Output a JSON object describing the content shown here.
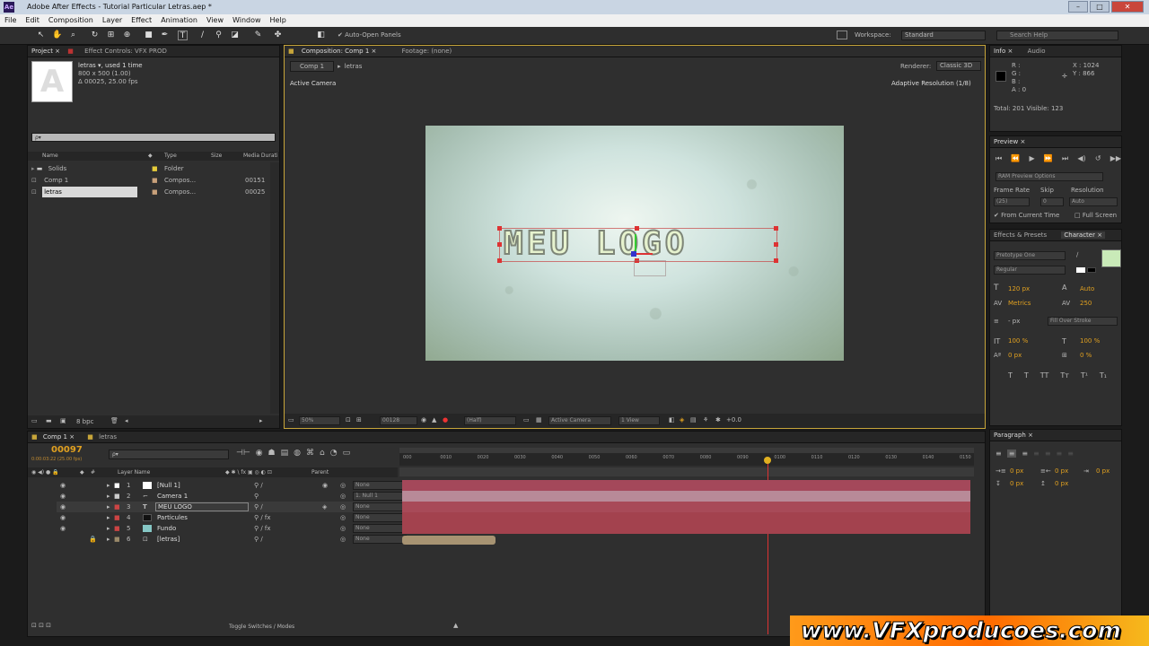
{
  "window": {
    "title": "Adobe After Effects - Tutorial Particular Letras.aep *",
    "app_badge": "Ae"
  },
  "menu": [
    "File",
    "Edit",
    "Composition",
    "Layer",
    "Effect",
    "Animation",
    "View",
    "Window",
    "Help"
  ],
  "toolbar": {
    "auto_open_panels": "Auto-Open Panels",
    "workspace_label": "Workspace:",
    "workspace_value": "Standard",
    "search_help": "Search Help"
  },
  "project": {
    "tab_project": "Project ×",
    "tab_effect_controls": "Effect Controls: VFX PROD",
    "item_name": "letras ▾",
    "item_used": ", used 1 time",
    "item_size": "800 x 500 (1.00)",
    "item_duration": "Δ 00025, 25.00 fps",
    "columns": [
      "Name",
      "Type",
      "Size",
      "Media Durati"
    ],
    "items": [
      {
        "name": "Solids",
        "type": "Folder",
        "dur": ""
      },
      {
        "name": "Comp 1",
        "type": "Compos...",
        "dur": "00151"
      },
      {
        "name": "letras",
        "type": "Compos...",
        "dur": "00025"
      }
    ],
    "bpc": "8 bpc"
  },
  "composition": {
    "tab": "Composition: Comp 1 ×",
    "footage_tab": "Footage: (none)",
    "breadcrumb": [
      "Comp 1",
      "letras"
    ],
    "renderer_label": "Renderer:",
    "renderer_value": "Classic 3D",
    "active_camera": "Active Camera",
    "adaptive": "Adaptive Resolution (1/8)",
    "logo_text": "MEU LOGO",
    "zoom": "50%",
    "timecode": "00128",
    "resolution": "(Half)",
    "camera_view": "Active Camera",
    "views": "1 View",
    "exposure": "+0.0"
  },
  "info": {
    "tab_info": "Info ×",
    "tab_audio": "Audio",
    "rgb": [
      "R :",
      "G :",
      "B :",
      "A : 0"
    ],
    "x": "X : 1024",
    "y": "Y : 866",
    "total": "Total: 201   Visible: 123"
  },
  "preview": {
    "tab": "Preview ×",
    "ram_options": "RAM Preview Options",
    "frame_rate_label": "Frame Rate",
    "skip_label": "Skip",
    "resolution_label": "Resolution",
    "frame_rate": "(25)",
    "skip": "0",
    "resolution": "Auto",
    "from_current": "From Current Time",
    "full_screen": "Full Screen"
  },
  "character": {
    "tab_effects": "Effects & Presets",
    "tab_character": "Character ×",
    "font": "Pretotype One",
    "style": "Regular",
    "size": "120 px",
    "leading": "Auto",
    "kerning": "Metrics",
    "tracking": "250",
    "stroke_width": "- px",
    "stroke_type": "Fill Over Stroke",
    "vscale": "100 %",
    "hscale": "100 %",
    "baseline": "0 px",
    "tsume": "0 %",
    "text_color": "#c9eab8"
  },
  "paragraph": {
    "tab": "Paragraph ×",
    "indent_left": "0 px",
    "indent_right": "0 px",
    "space_before": "0 px",
    "indent_first": "0 px",
    "space_after": "0 px"
  },
  "timeline": {
    "tab_comp": "Comp 1 ×",
    "tab_letras": "letras",
    "timecode": "00097",
    "timecode_sub": "0:00:03:22 (25.00 fps)",
    "search_placeholder": "ρ▾",
    "header_layer": "Layer Name",
    "header_parent": "Parent",
    "ruler": [
      "000",
      "0010",
      "0020",
      "0030",
      "0040",
      "0050",
      "0060",
      "0070",
      "0080",
      "0090",
      "0100",
      "0110",
      "0120",
      "0130",
      "0140",
      "0150"
    ],
    "layers": [
      {
        "num": "1",
        "name": "[Null 1]",
        "parent": "None",
        "label_color": "#ffffff"
      },
      {
        "num": "2",
        "name": "Camera 1",
        "parent": "1. Null 1",
        "label_color": "#cccccc"
      },
      {
        "num": "3",
        "name": "MEU LOGO",
        "parent": "None",
        "label_color": "#cc4444"
      },
      {
        "num": "4",
        "name": "Particules",
        "parent": "None",
        "label_color": "#111111"
      },
      {
        "num": "5",
        "name": "Fundo",
        "parent": "None",
        "label_color": "#86c7c5"
      },
      {
        "num": "6",
        "name": "[letras]",
        "parent": "None",
        "label_color": "#9a8a6a"
      }
    ],
    "toggle": "Toggle Switches / Modes"
  },
  "watermark": "www.VFXproducoes.com"
}
